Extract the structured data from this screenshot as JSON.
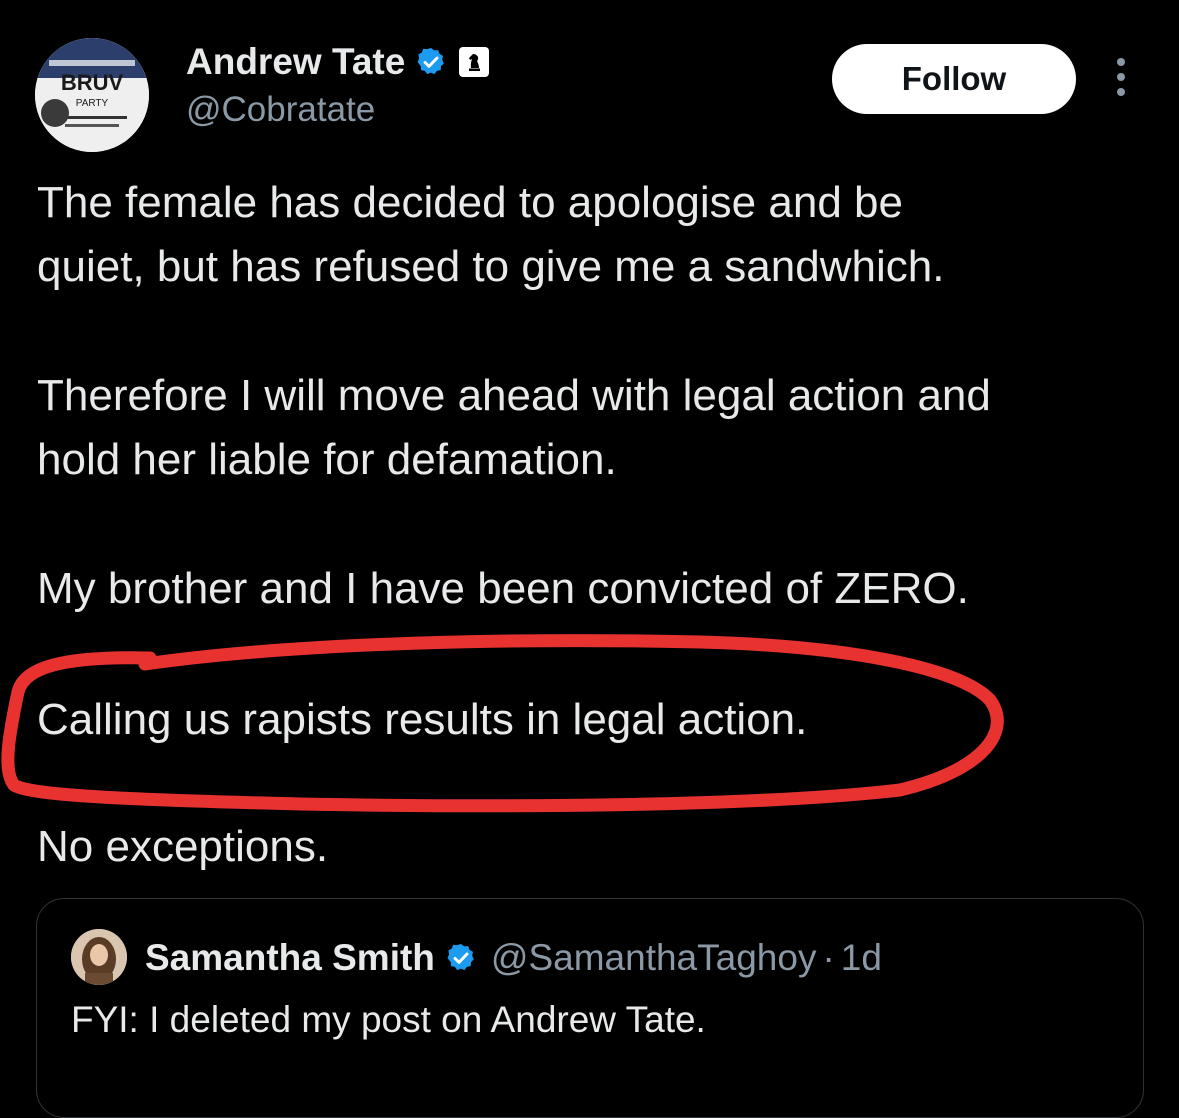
{
  "tweet": {
    "author": {
      "display_name": "Andrew Tate",
      "handle": "@Cobratate",
      "verified_icon": "verified-badge-icon",
      "affiliation_icon": "chess-knight-icon",
      "avatar_text": "BRUV",
      "avatar_subtext": "PARTY"
    },
    "follow_label": "Follow",
    "paragraphs": [
      "The female has decided to apologise and be\nquiet, but has refused to give me a sandwhich.",
      "Therefore I will move ahead with legal action and\nhold her liable for defamation.",
      "My brother and I have been convicted of ZERO.",
      "Calling us rapists results in legal action.",
      "No exceptions."
    ],
    "highlight_color": "#e8322f"
  },
  "quoted_tweet": {
    "display_name": "Samantha Smith",
    "handle": "@SamanthaTaghoy",
    "separator": "·",
    "time": "1d",
    "text": "FYI: I deleted my post on Andrew Tate."
  },
  "colors": {
    "background": "#000000",
    "text": "#e7e9ea",
    "muted": "#8b98a5",
    "verified_blue": "#1d9bf0"
  }
}
